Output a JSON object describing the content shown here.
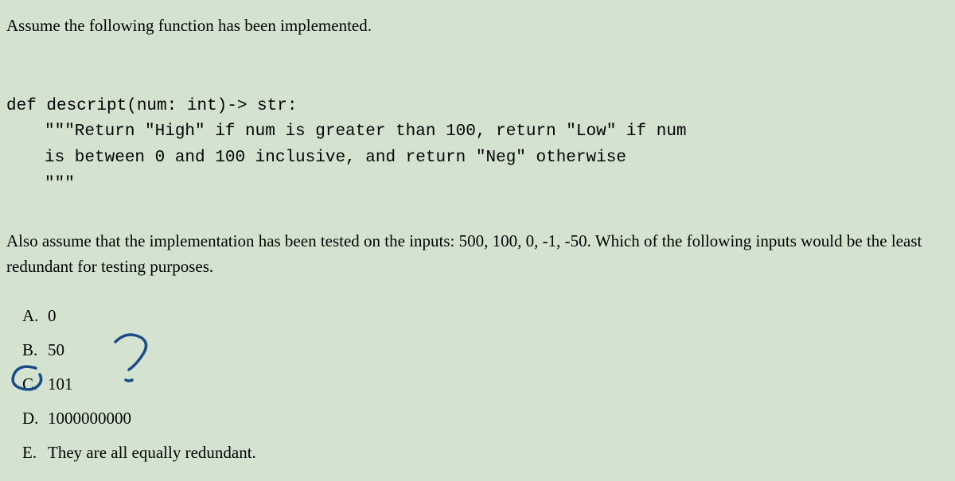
{
  "intro": "Assume the following function has been implemented.",
  "code": {
    "line1": "def descript(num: int)-> str:",
    "line2": "\"\"\"Return \"High\" if num is greater than 100, return \"Low\" if num",
    "line3": "is between 0 and 100 inclusive, and return \"Neg\" otherwise",
    "line4": "\"\"\""
  },
  "followup": "Also assume that the implementation has been tested on the inputs: 500, 100, 0, -1, -50.  Which of the following inputs would be the least redundant for testing purposes.",
  "options": [
    {
      "letter": "A.",
      "value": "0"
    },
    {
      "letter": "B.",
      "value": "50"
    },
    {
      "letter": "C.",
      "value": "101"
    },
    {
      "letter": "D.",
      "value": "1000000000"
    },
    {
      "letter": "E.",
      "value": "They are all equally redundant."
    }
  ],
  "annotations": {
    "circled_option": "C",
    "question_mark_near": "B-C"
  }
}
